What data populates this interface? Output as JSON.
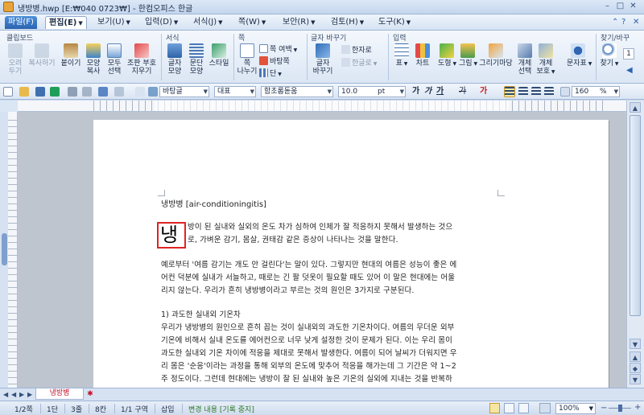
{
  "window": {
    "title": "냉방병.hwp [E:₩040 0723₩] - 한컴오피스 한글",
    "controls": [
      "–",
      "□",
      "✕"
    ]
  },
  "menu": {
    "items": [
      "파일(F)",
      "편집(E)",
      "보기(U)",
      "입력(D)",
      "서식(J)",
      "쪽(W)",
      "보안(R)",
      "검토(H)",
      "도구(K)"
    ],
    "right_icons": [
      "?",
      "✕"
    ]
  },
  "ribbon": {
    "groups": {
      "clipboard": "클립보드",
      "format": "서식",
      "page": "쪽",
      "fontchange": "글자 바꾸기",
      "insert": "입력",
      "find": "찾기/바꾸"
    },
    "clipboard_buttons": [
      {
        "line1": "오려",
        "line2": "두기",
        "disabled": true
      },
      {
        "line1": "복사하기",
        "line2": "",
        "disabled": true
      },
      {
        "line1": "붙이기",
        "line2": "",
        "disabled": false
      },
      {
        "line1": "모양",
        "line2": "복사",
        "disabled": false
      },
      {
        "line1": "모두",
        "line2": "선택",
        "disabled": false
      },
      {
        "line1": "조판 부호",
        "line2": "지우기",
        "disabled": false
      }
    ],
    "format_buttons": [
      {
        "line1": "글자",
        "line2": "모양"
      },
      {
        "line1": "문단",
        "line2": "모양"
      },
      {
        "line1": "스타일",
        "line2": ""
      }
    ],
    "page_buttons": {
      "big": {
        "line1": "쪽",
        "line2": "나누기"
      },
      "small": [
        "쪽 여백",
        "바탕쪽",
        "단"
      ]
    },
    "fontchange": {
      "big": {
        "line1": "글자",
        "line2": "바꾸기"
      },
      "small": [
        "한자로",
        "한글로"
      ]
    },
    "insert_buttons": [
      {
        "line1": "표"
      },
      {
        "line1": "차트"
      },
      {
        "line1": "도형"
      },
      {
        "line1": "그림"
      },
      {
        "line1": "그리기마당"
      },
      {
        "line1": "개체",
        "line2": "선택"
      },
      {
        "line1": "개체",
        "line2": "보호"
      },
      {
        "line1": "문자표"
      }
    ],
    "find_button": "찾기",
    "find_spinner": "1"
  },
  "toolbar": {
    "style_combo": "바탕글",
    "lang_combo": "대표",
    "font_combo": "함초롬돋움",
    "size_combo": "10.0",
    "size_unit": "pt",
    "bold_label": "가",
    "italic_label": "가",
    "underline_label": "가",
    "strike_label": "가",
    "color_label": "가",
    "zoom_combo": "160",
    "zoom_unit": "%"
  },
  "document": {
    "heading": "냉방병 [air-conditioningitis]",
    "dropcap": "냉",
    "para1": [
      "방이 된 실내와 실외의 온도 차가 심하여 인체가 잘 적응하지 못해서 발생하는 것으",
      "로, 가벼운 감기, 몸살, 권태감 같은 증상이 나타나는 것을 말한다."
    ],
    "para2": [
      "예로부터 '여름 감기는 개도 안 걸린다'는 말이 있다. 그렇지만 현대의 여름은 성능이 좋은 에",
      "어컨 덕분에 실내가 서늘하고, 때로는 긴 팔 덧옷이 필요할 때도 있어 이 말은 현대에는 어울",
      "리지 않는다. 우리가 흔히 냉방병이라고 부르는 것의 원인은 3가지로 구분된다."
    ],
    "subheading": "1) 과도한 실내외 기온차",
    "para3": [
      "우리가 냉방병의 원인으로 흔히 꼽는 것이 실내외의 과도한 기온차이다. 여름의 무더운 외부",
      "기온에 비해서 실내 온도를 에어컨으로 너무 낮게 설정한 것이 문제가 된다. 이는 우리 몸이",
      "과도한 실내외 기온 차이에 적응을 제대로 못해서 발생한다. 여름이 되어 날씨가 더워지면 우",
      "리 몸은 '순응'이라는 과정을 통해 외부의 온도에 맞추어 적응을 해가는데 그 기간은 약 1~2",
      "주 정도이다. 그런데 현대에는 냉방이 잘 된 실내와 높은 기온의 실외에 지내는 것을 반복하"
    ]
  },
  "doc_tab": "냉방병",
  "status": {
    "page": "1/2쪽",
    "column": "1단",
    "line": "3줄",
    "char": "8칸",
    "section": "1/1 구역",
    "mode": "삽입",
    "track": "변경 내용 [기록 중지]",
    "zoom": "100%"
  }
}
